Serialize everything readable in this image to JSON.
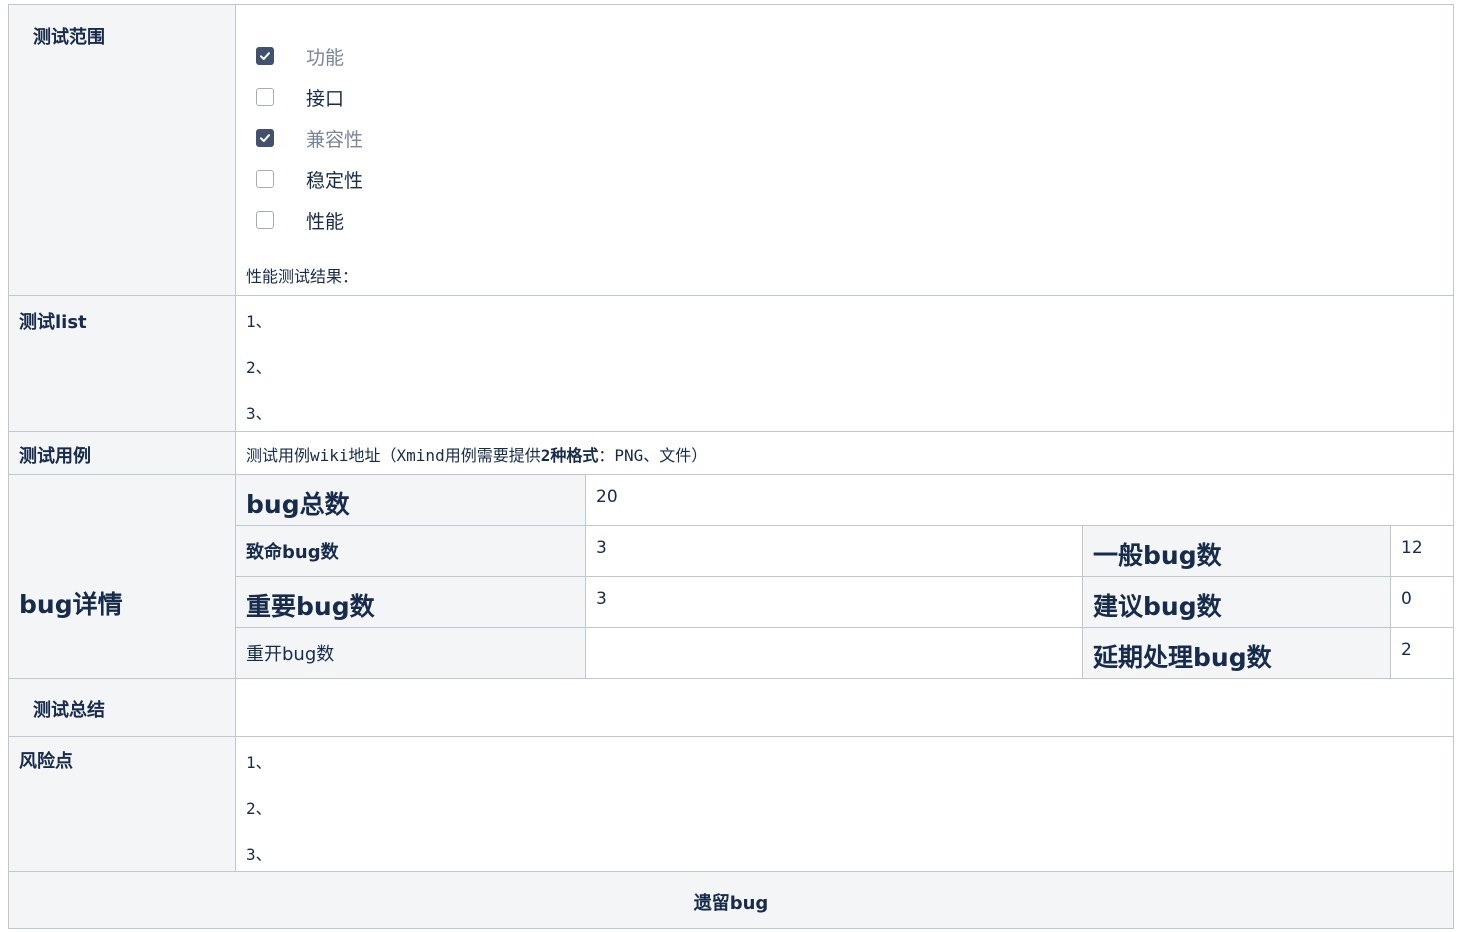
{
  "scope": {
    "label": "测试范围",
    "options": [
      {
        "text": "功能",
        "checked": true
      },
      {
        "text": "接口",
        "checked": false
      },
      {
        "text": "兼容性",
        "checked": true
      },
      {
        "text": "稳定性",
        "checked": false
      },
      {
        "text": "性能",
        "checked": false
      }
    ],
    "perf_result": "性能测试结果："
  },
  "test_list": {
    "label": "测试list",
    "items": [
      "1、",
      "2、",
      "3、"
    ]
  },
  "test_case": {
    "label": "测试用例",
    "text_prefix": "测试用例wiki地址（Xmind用例需要提供",
    "text_bold": "2种格式",
    "text_suffix": "：PNG、文件）"
  },
  "bug_detail": {
    "label": "bug详情",
    "total_label": "bug总数",
    "total_value": "20",
    "fatal_label": "致命bug数",
    "fatal_value": "3",
    "normal_label": "一般bug数",
    "normal_value": "12",
    "major_label": "重要bug数",
    "major_value": "3",
    "suggest_label": "建议bug数",
    "suggest_value": "0",
    "reopen_label": "重开bug数",
    "reopen_value": "",
    "deferred_label": "延期处理bug数",
    "deferred_value": "2"
  },
  "summary": {
    "label": "测试总结",
    "value": ""
  },
  "risk": {
    "label": "风险点",
    "items": [
      "1、",
      "2、",
      "3、"
    ]
  },
  "remaining": {
    "label": "遗留bug"
  }
}
